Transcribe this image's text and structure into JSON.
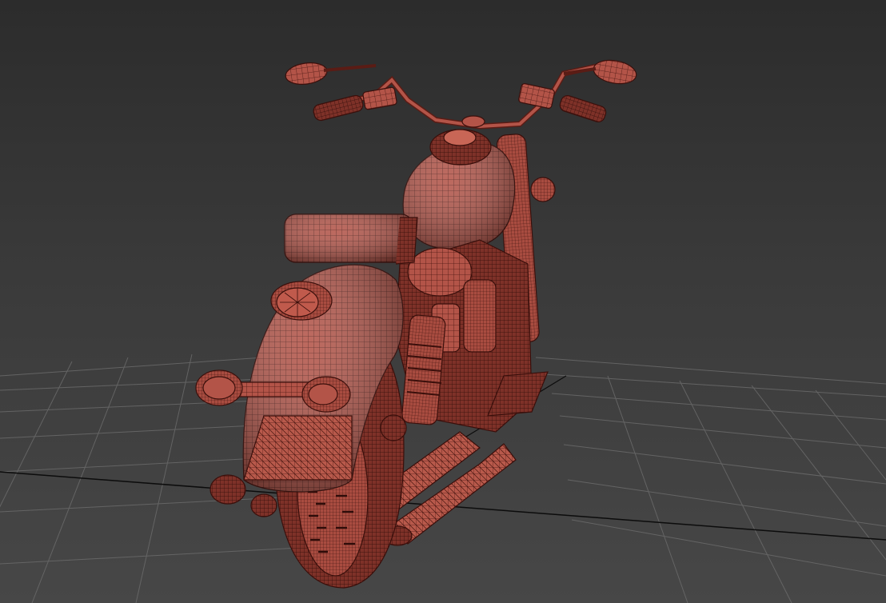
{
  "viewport": {
    "view": "perspective",
    "shading": "wireframe-over-shaded",
    "background_top": "#2c2c2c",
    "background_bottom": "#474747",
    "grid_visible": true,
    "grid_color": "#6a6a6a",
    "axis_line_color": "#0c0c0c"
  },
  "model": {
    "subject": "motorcycle",
    "material_color": "#b35448",
    "wire_color": "#4a1712"
  }
}
